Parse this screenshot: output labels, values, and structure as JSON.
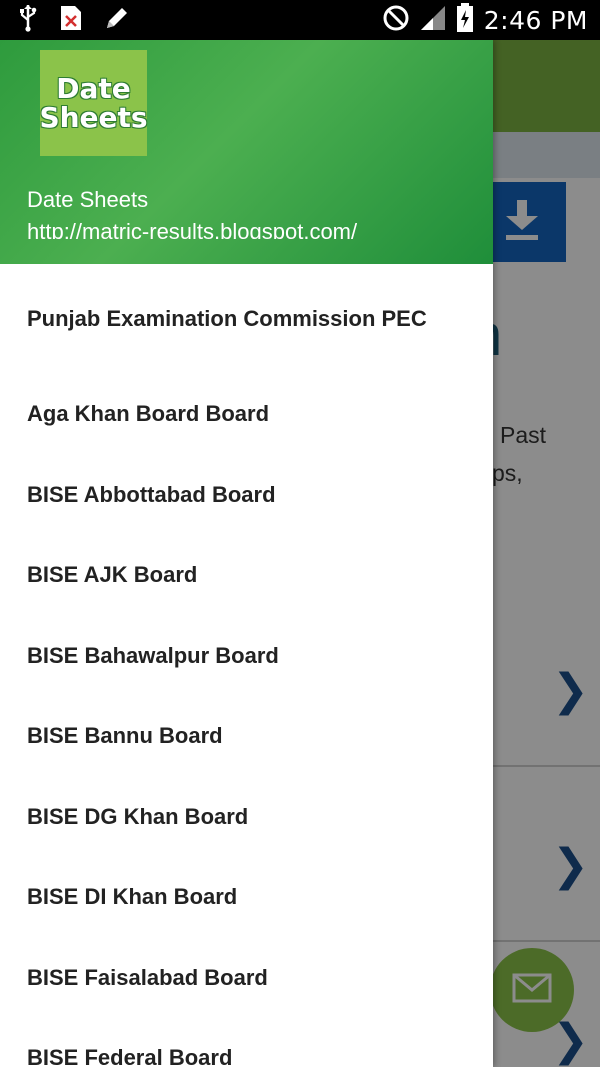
{
  "status_bar": {
    "time": "2:46 PM",
    "left_icons": [
      "usb-icon",
      "file-error-icon",
      "pencil-icon"
    ],
    "right_icons": [
      "do-not-disturb-icon",
      "signal-icon",
      "battery-charging-icon"
    ]
  },
  "drawer": {
    "header": {
      "logo_line1": "Date",
      "logo_line2": "Sheets",
      "title": "Date Sheets",
      "subtitle": "http://matric-results.blogspot.com/"
    },
    "items": [
      {
        "label": "Punjab Examination Commission PEC"
      },
      {
        "label": "Aga Khan Board Board"
      },
      {
        "label": "BISE Abbottabad Board"
      },
      {
        "label": "BISE AJK Board"
      },
      {
        "label": "BISE Bahawalpur Board"
      },
      {
        "label": "BISE Bannu Board"
      },
      {
        "label": "BISE DG Khan Board"
      },
      {
        "label": "BISE DI Khan Board"
      },
      {
        "label": "BISE Faisalabad Board"
      },
      {
        "label": "BISE Federal Board"
      }
    ]
  },
  "background": {
    "partial_texts": [
      "n",
      "s",
      "Past",
      "ps,"
    ],
    "colors": {
      "toolbar": "#7cb342",
      "download_button": "#1565c0",
      "fab": "#8bc34a",
      "chevron": "#1d4f8a"
    }
  }
}
